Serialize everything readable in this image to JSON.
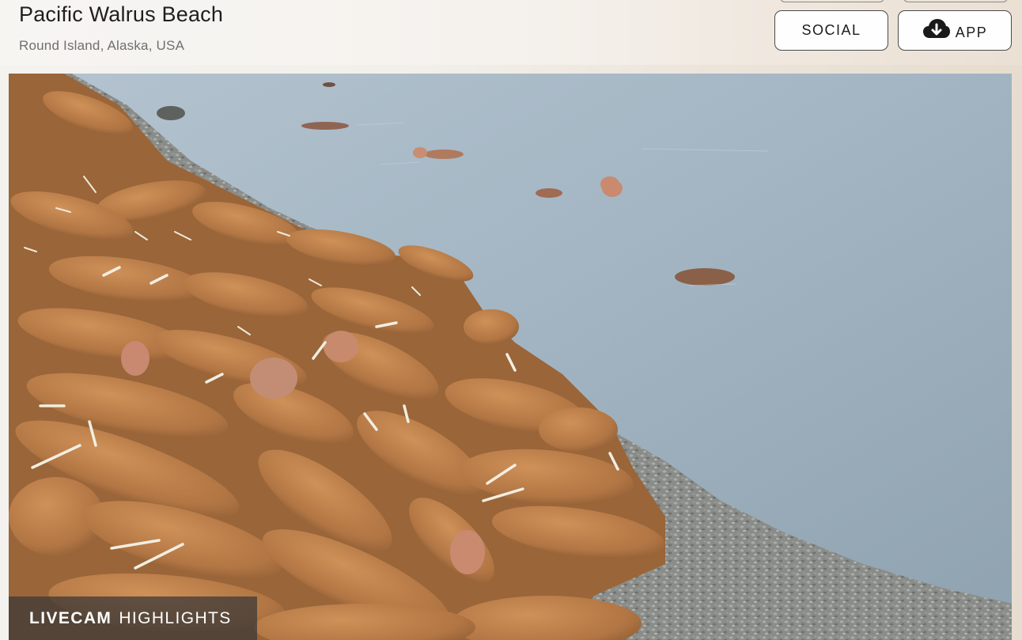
{
  "header": {
    "title": "Pacific Walrus Beach",
    "subtitle": "Round Island, Alaska, USA"
  },
  "buttons": {
    "social": "SOCIAL",
    "app": "APP",
    "app_icon": "cloud-download-icon"
  },
  "video": {
    "scene": "walrus-haulout-livestream",
    "highlight_bar": {
      "strong": "LIVECAM",
      "light": "HIGHLIGHTS"
    }
  },
  "colors": {
    "water": "#9fb2c0",
    "walrus": "#b57a45",
    "gravel": "#8c8e8c"
  }
}
